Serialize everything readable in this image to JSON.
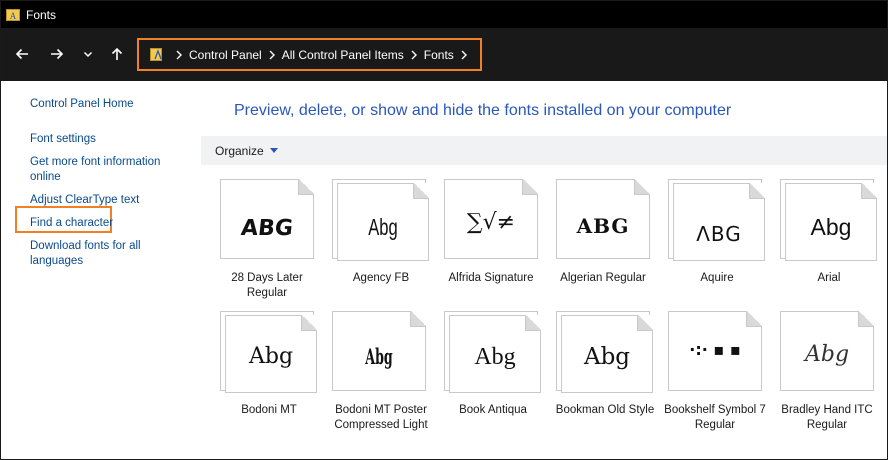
{
  "window": {
    "title": "Fonts"
  },
  "address": {
    "crumbs": [
      "Control Panel",
      "All Control Panel Items",
      "Fonts"
    ]
  },
  "left_pane": {
    "home": "Control Panel Home",
    "font_settings": "Font settings",
    "more_info": "Get more font information online",
    "cleartype": "Adjust ClearType text",
    "find_char": "Find a character",
    "download": "Download fonts for all languages"
  },
  "main": {
    "heading": "Preview, delete, or show and hide the fonts installed on your computer",
    "organize": "Organize"
  },
  "fonts": [
    {
      "name": "28 Days Later Regular",
      "sample": "ABG"
    },
    {
      "name": "Agency FB",
      "sample": "Abg"
    },
    {
      "name": "Alfrida Signature",
      "sample": "∑√≠"
    },
    {
      "name": "Algerian Regular",
      "sample": "ABG"
    },
    {
      "name": "Aquire",
      "sample": "ΛBG"
    },
    {
      "name": "Arial",
      "sample": "Abg"
    },
    {
      "name": "Bodoni MT",
      "sample": "Abg"
    },
    {
      "name": "Bodoni MT Poster Compressed Light",
      "sample": "Abg"
    },
    {
      "name": "Book Antiqua",
      "sample": "Abg"
    },
    {
      "name": "Bookman Old Style",
      "sample": "Abg"
    },
    {
      "name": "Bookshelf Symbol 7 Regular",
      "sample": "·:·  ▪  ▪"
    },
    {
      "name": "Bradley Hand ITC Regular",
      "sample": "Abg"
    }
  ],
  "colors": {
    "accent_highlight": "#f08023",
    "link": "#0a4a8c",
    "heading": "#2a57b8"
  }
}
